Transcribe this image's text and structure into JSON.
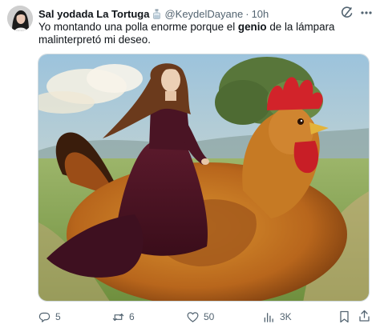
{
  "post": {
    "display_name": "Sal yodada La Tortuga",
    "handle": "@KeydelDayane",
    "separator": "·",
    "timestamp": "10h",
    "text_before": "Yo montando una polla enorme porque el ",
    "text_bold": "genio",
    "text_after": " de la lámpara malinterpretó mi deseo.",
    "media_icon_names": [
      "grok-icon",
      "more-icon"
    ]
  },
  "actions": {
    "reply_count": "5",
    "retweet_count": "6",
    "like_count": "50",
    "views_count": "3K"
  },
  "colors": {
    "text_primary": "#0f1419",
    "text_secondary": "#536471",
    "border": "#cfd9de"
  }
}
